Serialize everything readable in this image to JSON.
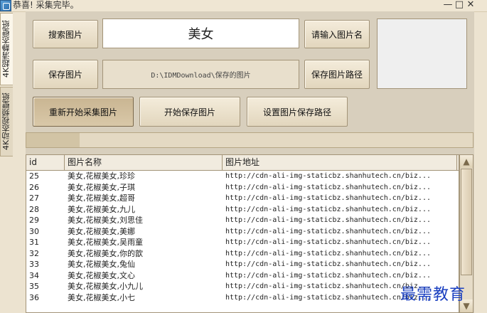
{
  "window": {
    "title": "恭喜! 采集完毕。",
    "minimize": "—",
    "maximize": "□",
    "close": "✕"
  },
  "left_tabs": [
    "4K超清静态壁纸",
    "4K动态视频壁纸"
  ],
  "search": {
    "button": "搜索图片",
    "value": "美女",
    "hint_button": "请输入图片名"
  },
  "save": {
    "button": "保存图片",
    "path": "D:\\IDMDownload\\保存的图片",
    "path_button": "保存图片路径"
  },
  "actions": {
    "restart": "重新开始采集图片",
    "start_save": "开始保存图片",
    "set_path": "设置图片保存路径"
  },
  "progress": {
    "value": 0.12
  },
  "table": {
    "headers": [
      "id",
      "图片名称",
      "图片地址"
    ],
    "rows": [
      [
        "25",
        "美女,花椒美女,珍珍",
        "http://cdn-ali-img-staticbz.shanhutech.cn/biz..."
      ],
      [
        "26",
        "美女,花椒美女,子琪",
        "http://cdn-ali-img-staticbz.shanhutech.cn/biz..."
      ],
      [
        "27",
        "美女,花椒美女,超哥",
        "http://cdn-ali-img-staticbz.shanhutech.cn/biz..."
      ],
      [
        "28",
        "美女,花椒美女,九儿",
        "http://cdn-ali-img-staticbz.shanhutech.cn/biz..."
      ],
      [
        "29",
        "美女,花椒美女,刘思佳",
        "http://cdn-ali-img-staticbz.shanhutech.cn/biz..."
      ],
      [
        "30",
        "美女,花椒美女,美娜",
        "http://cdn-ali-img-staticbz.shanhutech.cn/biz..."
      ],
      [
        "31",
        "美女,花椒美女,吴雨童",
        "http://cdn-ali-img-staticbz.shanhutech.cn/biz..."
      ],
      [
        "32",
        "美女,花椒美女,你的歆",
        "http://cdn-ali-img-staticbz.shanhutech.cn/biz..."
      ],
      [
        "33",
        "美女,花椒美女,兔仙",
        "http://cdn-ali-img-staticbz.shanhutech.cn/biz..."
      ],
      [
        "34",
        "美女,花椒美女,文心",
        "http://cdn-ali-img-staticbz.shanhutech.cn/biz..."
      ],
      [
        "35",
        "美女,花椒美女,小九儿",
        "http://cdn-ali-img-staticbz.shanhutech.cn/biz..."
      ],
      [
        "36",
        "美女,花椒美女,小七",
        "http://cdn-ali-img-staticbz.shanhutech.cn/biz..."
      ]
    ]
  },
  "scroll_icons": {
    "up": "up-arrow-icon",
    "down": "down-arrow-icon"
  },
  "watermark": "最需教育",
  "colors": {
    "watermark": "#1a3fc0",
    "background": "#ece3d0"
  }
}
